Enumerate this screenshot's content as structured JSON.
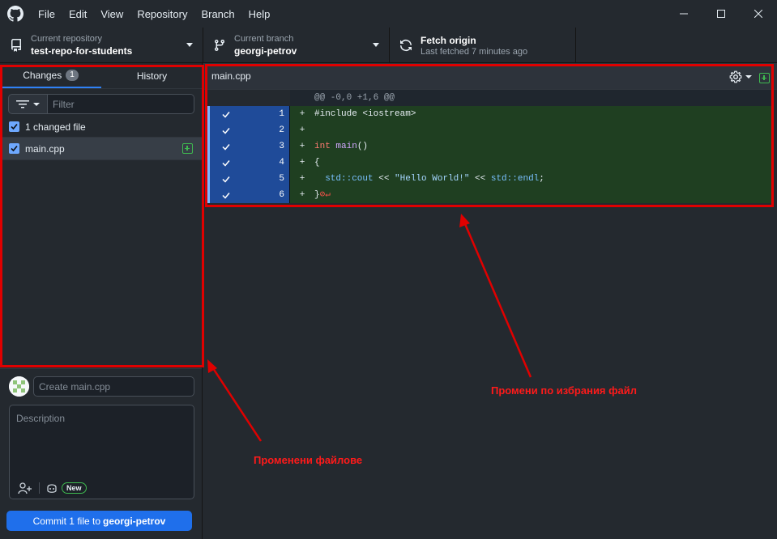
{
  "menu": [
    "File",
    "Edit",
    "View",
    "Repository",
    "Branch",
    "Help"
  ],
  "toolbar": {
    "repo": {
      "label": "Current repository",
      "value": "test-repo-for-students"
    },
    "branch": {
      "label": "Current branch",
      "value": "georgi-petrov"
    },
    "fetch": {
      "label": "Fetch origin",
      "sub": "Last fetched 7 minutes ago"
    }
  },
  "sidebar": {
    "tabs": {
      "changes": "Changes",
      "changes_count": "1",
      "history": "History"
    },
    "filter_placeholder": "Filter",
    "changed_files_label": "1 changed file",
    "files": [
      {
        "name": "main.cpp"
      }
    ]
  },
  "commit": {
    "summary_placeholder": "Create main.cpp",
    "description_placeholder": "Description",
    "new_badge": "New",
    "button_prefix": "Commit 1 file to",
    "button_branch": "georgi-petrov"
  },
  "diff": {
    "filename": "main.cpp",
    "hunk": "@@ -0,0 +1,6 @@",
    "lines": [
      {
        "num": "1",
        "sign": "+"
      },
      {
        "num": "2",
        "sign": "+"
      },
      {
        "num": "3",
        "sign": "+"
      },
      {
        "num": "4",
        "sign": "+"
      },
      {
        "num": "5",
        "sign": "+"
      },
      {
        "num": "6",
        "sign": "+"
      }
    ],
    "code": {
      "l1": "#include <iostream>",
      "l3_kw": "int",
      "l3_fn": "main",
      "l3_rest": "()",
      "l4": "{",
      "l5_indent": "  ",
      "l5_ns1": "std::cout",
      "l5_op1": " << ",
      "l5_str": "\"Hello World!\"",
      "l5_op2": " << ",
      "l5_ns2": "std::endl",
      "l5_end": ";",
      "l6": "}",
      "l6_eol": "⊘↵"
    }
  },
  "annotations": {
    "changed_files": "Променени файлове",
    "selected_file_changes": "Промени по избрания файл"
  },
  "colors": {
    "annotation": "#e00000",
    "accent": "#1f6feb",
    "added": "#3fb950"
  }
}
